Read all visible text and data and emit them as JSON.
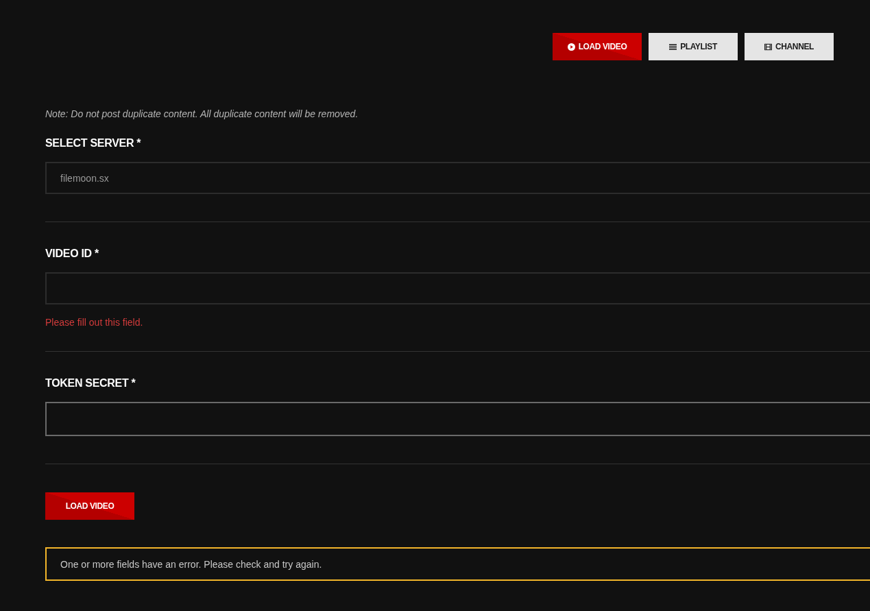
{
  "mode_tabs": [
    {
      "kind": "video",
      "label": "LOAD VIDEO",
      "selected": true
    },
    {
      "kind": "playlist",
      "label": "PLAYLIST",
      "selected": false
    },
    {
      "kind": "channel",
      "label": "CHANNEL",
      "selected": false
    }
  ],
  "note": "Note: Do not post duplicate content. All duplicate content will be removed.",
  "fields": [
    {
      "label": "SELECT SERVER *",
      "value": "filemoon.sx",
      "focused": false
    },
    {
      "label": "VIDEO ID *",
      "focused": false,
      "error": "Please fill out this field."
    },
    {
      "label": "TOKEN SECRET *",
      "focused": true
    }
  ],
  "submit_button": {
    "label": "LOAD VIDEO"
  },
  "alert": {
    "kind": "warning",
    "message": "One or more fields have an error. Please check and try again."
  }
}
